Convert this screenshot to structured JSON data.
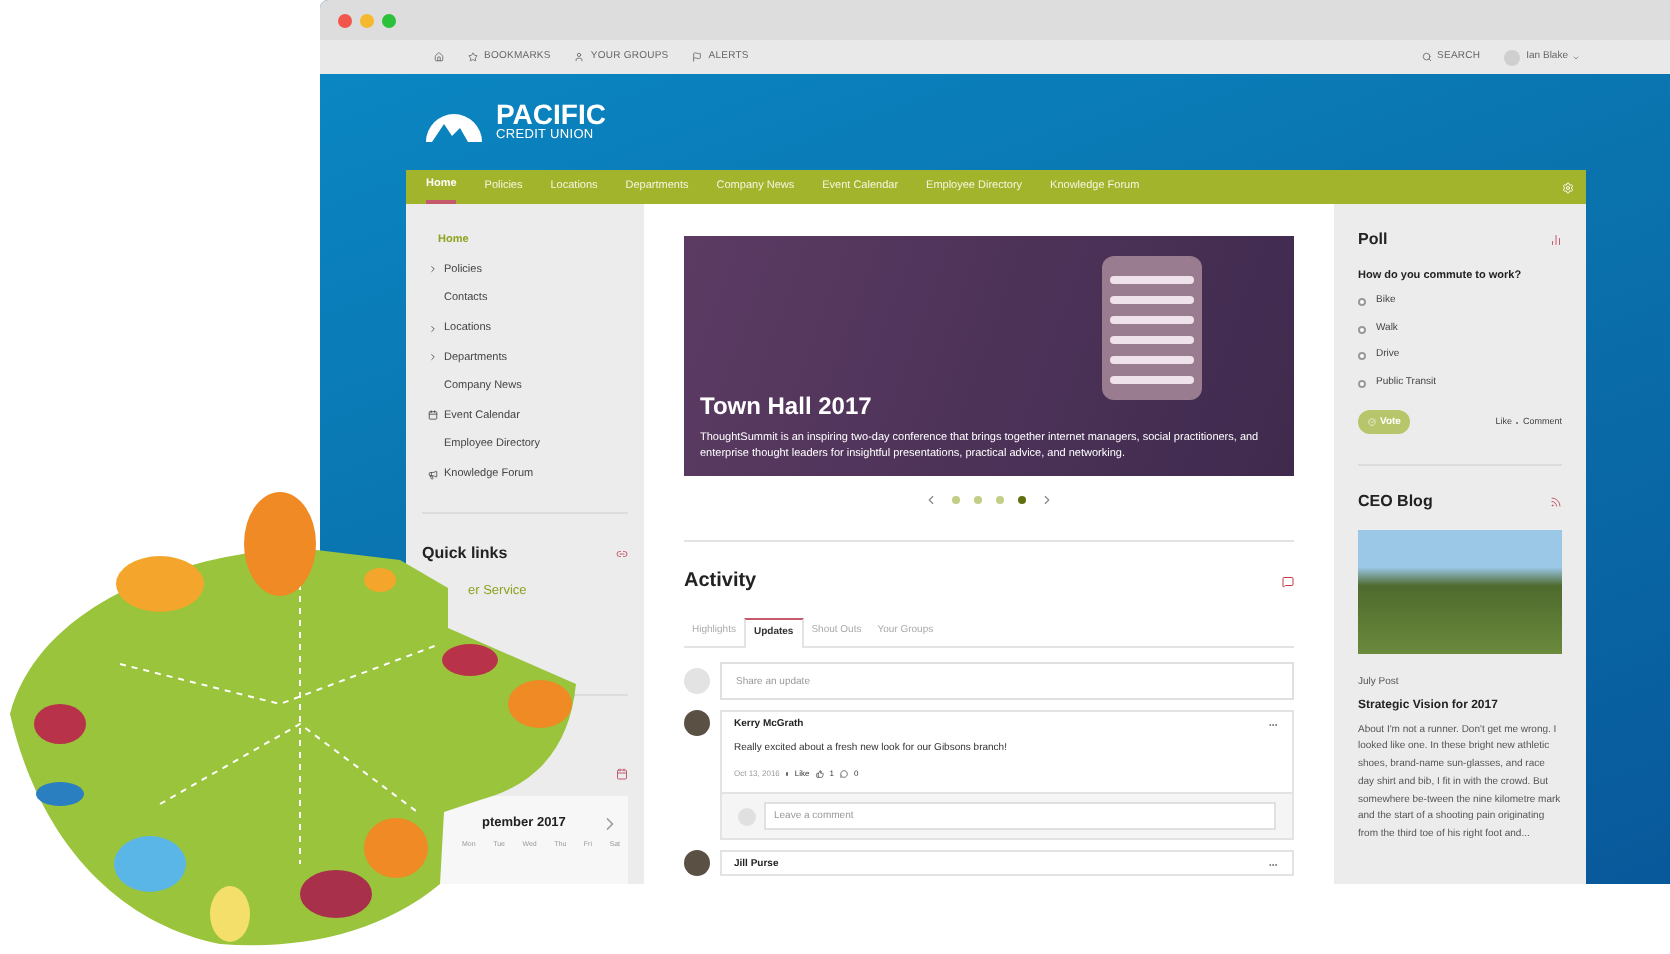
{
  "topbar": {
    "links": [
      {
        "label": "BOOKMARKS"
      },
      {
        "label": "YOUR GROUPS"
      },
      {
        "label": "ALERTS"
      }
    ],
    "search": "SEARCH",
    "user": "Ian Blake"
  },
  "logo": {
    "name": "PACIFIC",
    "tagline": "CREDIT UNION"
  },
  "nav": [
    {
      "label": "Home",
      "selected": true
    },
    {
      "label": "Policies",
      "selected": false
    },
    {
      "label": "Locations",
      "selected": false
    },
    {
      "label": "Departments",
      "selected": false
    },
    {
      "label": "Company News",
      "selected": false
    },
    {
      "label": "Event Calendar",
      "selected": false
    },
    {
      "label": "Employee Directory",
      "selected": false
    },
    {
      "label": "Knowledge Forum",
      "selected": false
    }
  ],
  "sidebar": {
    "items": [
      {
        "label": "Home",
        "selected": true,
        "kind": "page"
      },
      {
        "label": "Policies",
        "selected": false,
        "kind": "expandable"
      },
      {
        "label": "Contacts",
        "selected": false,
        "kind": "page"
      },
      {
        "label": "Locations",
        "selected": false,
        "kind": "expandable"
      },
      {
        "label": "Departments",
        "selected": false,
        "kind": "expandable"
      },
      {
        "label": "Company News",
        "selected": false,
        "kind": "page"
      },
      {
        "label": "Event Calendar",
        "selected": false,
        "kind": "calendar"
      },
      {
        "label": "Employee Directory",
        "selected": false,
        "kind": "page"
      },
      {
        "label": "Knowledge Forum",
        "selected": false,
        "kind": "forum"
      }
    ],
    "quick_links": {
      "title": "Quick links",
      "items": [
        "er Service"
      ]
    },
    "calendar": {
      "month": "ptember 2017",
      "days": [
        "Mon",
        "Tue",
        "Wed",
        "Thu",
        "Fri",
        "Sat"
      ]
    }
  },
  "hero": {
    "title": "Town Hall 2017",
    "text": "ThoughtSummit is an inspiring two-day conference that brings together internet managers, social practitioners, and enterprise thought leaders for insightful presentations, practical advice, and networking.",
    "dots": [
      {
        "selected": false
      },
      {
        "selected": false
      },
      {
        "selected": false
      },
      {
        "selected": true
      }
    ]
  },
  "activity": {
    "title": "Activity",
    "tabs": [
      {
        "label": "Highlights",
        "selected": false
      },
      {
        "label": "Updates",
        "selected": true
      },
      {
        "label": "Shout Outs",
        "selected": false
      },
      {
        "label": "Your Groups",
        "selected": false
      }
    ],
    "share_placeholder": "Share an update",
    "posts": [
      {
        "author": "Kerry McGrath",
        "text": "Really excited about a fresh new look for our Gibsons branch!",
        "date": "Oct 13, 2016",
        "like": "Like",
        "likes": "1",
        "comments": "0",
        "comment_placeholder": "Leave a comment"
      },
      {
        "author": "Jill Purse"
      }
    ]
  },
  "poll": {
    "title": "Poll",
    "question": "How do you commute to work?",
    "options": [
      {
        "label": "Bike",
        "selected": false
      },
      {
        "label": "Walk",
        "selected": false
      },
      {
        "label": "Drive",
        "selected": false
      },
      {
        "label": "Public Transit",
        "selected": false
      }
    ],
    "vote": "Vote",
    "actions": [
      "Like",
      "Comment"
    ]
  },
  "blog": {
    "title": "CEO Blog",
    "category": "July Post",
    "post_title": "Strategic Vision for 2017",
    "excerpt": "About I'm not a runner. Don't get me wrong. I looked like one. In these bright new athletic shoes, brand-name sun-glasses, and race day shirt and bib, I fit in with the crowd. But somewhere be-tween the nine kilometre mark and the start of a shooting pain originating from the third toe of his right foot and..."
  }
}
